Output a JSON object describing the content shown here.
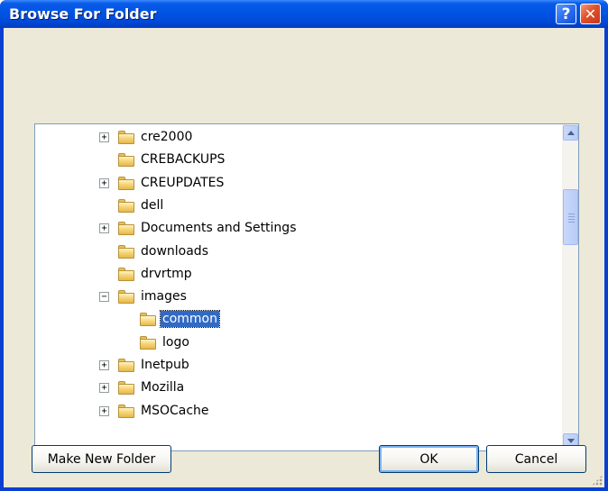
{
  "window": {
    "title": "Browse For Folder",
    "help_glyph": "?",
    "close_glyph": "✕"
  },
  "tree": {
    "items": [
      {
        "label": "cre2000",
        "expander": "+",
        "indent": 1,
        "selected": false
      },
      {
        "label": "CREBACKUPS",
        "expander": "",
        "indent": 1,
        "selected": false
      },
      {
        "label": "CREUPDATES",
        "expander": "+",
        "indent": 1,
        "selected": false
      },
      {
        "label": "dell",
        "expander": "",
        "indent": 1,
        "selected": false
      },
      {
        "label": "Documents and Settings",
        "expander": "+",
        "indent": 1,
        "selected": false
      },
      {
        "label": "downloads",
        "expander": "",
        "indent": 1,
        "selected": false
      },
      {
        "label": "drvrtmp",
        "expander": "",
        "indent": 1,
        "selected": false
      },
      {
        "label": "images",
        "expander": "−",
        "indent": 1,
        "selected": false
      },
      {
        "label": "common",
        "expander": "",
        "indent": 2,
        "selected": true
      },
      {
        "label": "logo",
        "expander": "",
        "indent": 2,
        "selected": false
      },
      {
        "label": "Inetpub",
        "expander": "+",
        "indent": 1,
        "selected": false
      },
      {
        "label": "Mozilla",
        "expander": "+",
        "indent": 1,
        "selected": false
      },
      {
        "label": "MSOCache",
        "expander": "+",
        "indent": 1,
        "selected": false
      }
    ]
  },
  "buttons": {
    "make_new_folder": "Make New Folder",
    "ok": "OK",
    "cancel": "Cancel"
  },
  "colors": {
    "titlebar": "#0054e3",
    "dialog_bg": "#ece9d8",
    "selection": "#316ac5"
  }
}
